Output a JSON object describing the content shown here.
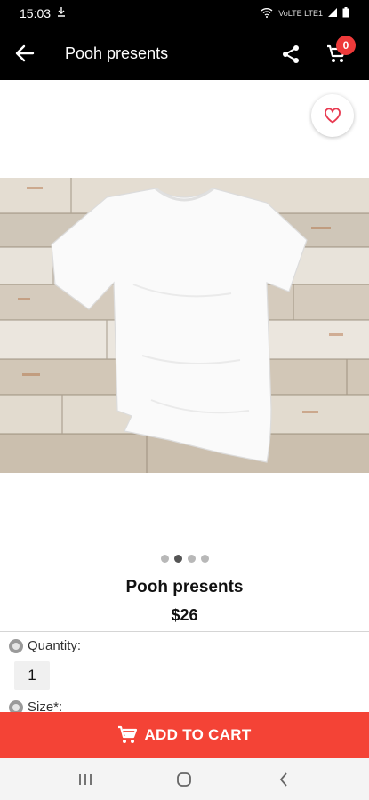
{
  "status_bar": {
    "time": "15:03",
    "signal_text": "VoLTE LTE1"
  },
  "app_bar": {
    "title": "Pooh presents",
    "cart_count": "0"
  },
  "product": {
    "name": "Pooh presents",
    "price": "$26",
    "image_count": 4,
    "active_image": 1
  },
  "options": {
    "quantity_label": "Quantity:",
    "quantity_value": "1",
    "size_label": "Size*:"
  },
  "add_to_cart": {
    "label": "ADD TO CART"
  },
  "colors": {
    "accent": "#f44336",
    "app_bar": "#000000",
    "badge": "#ee3a3a"
  }
}
